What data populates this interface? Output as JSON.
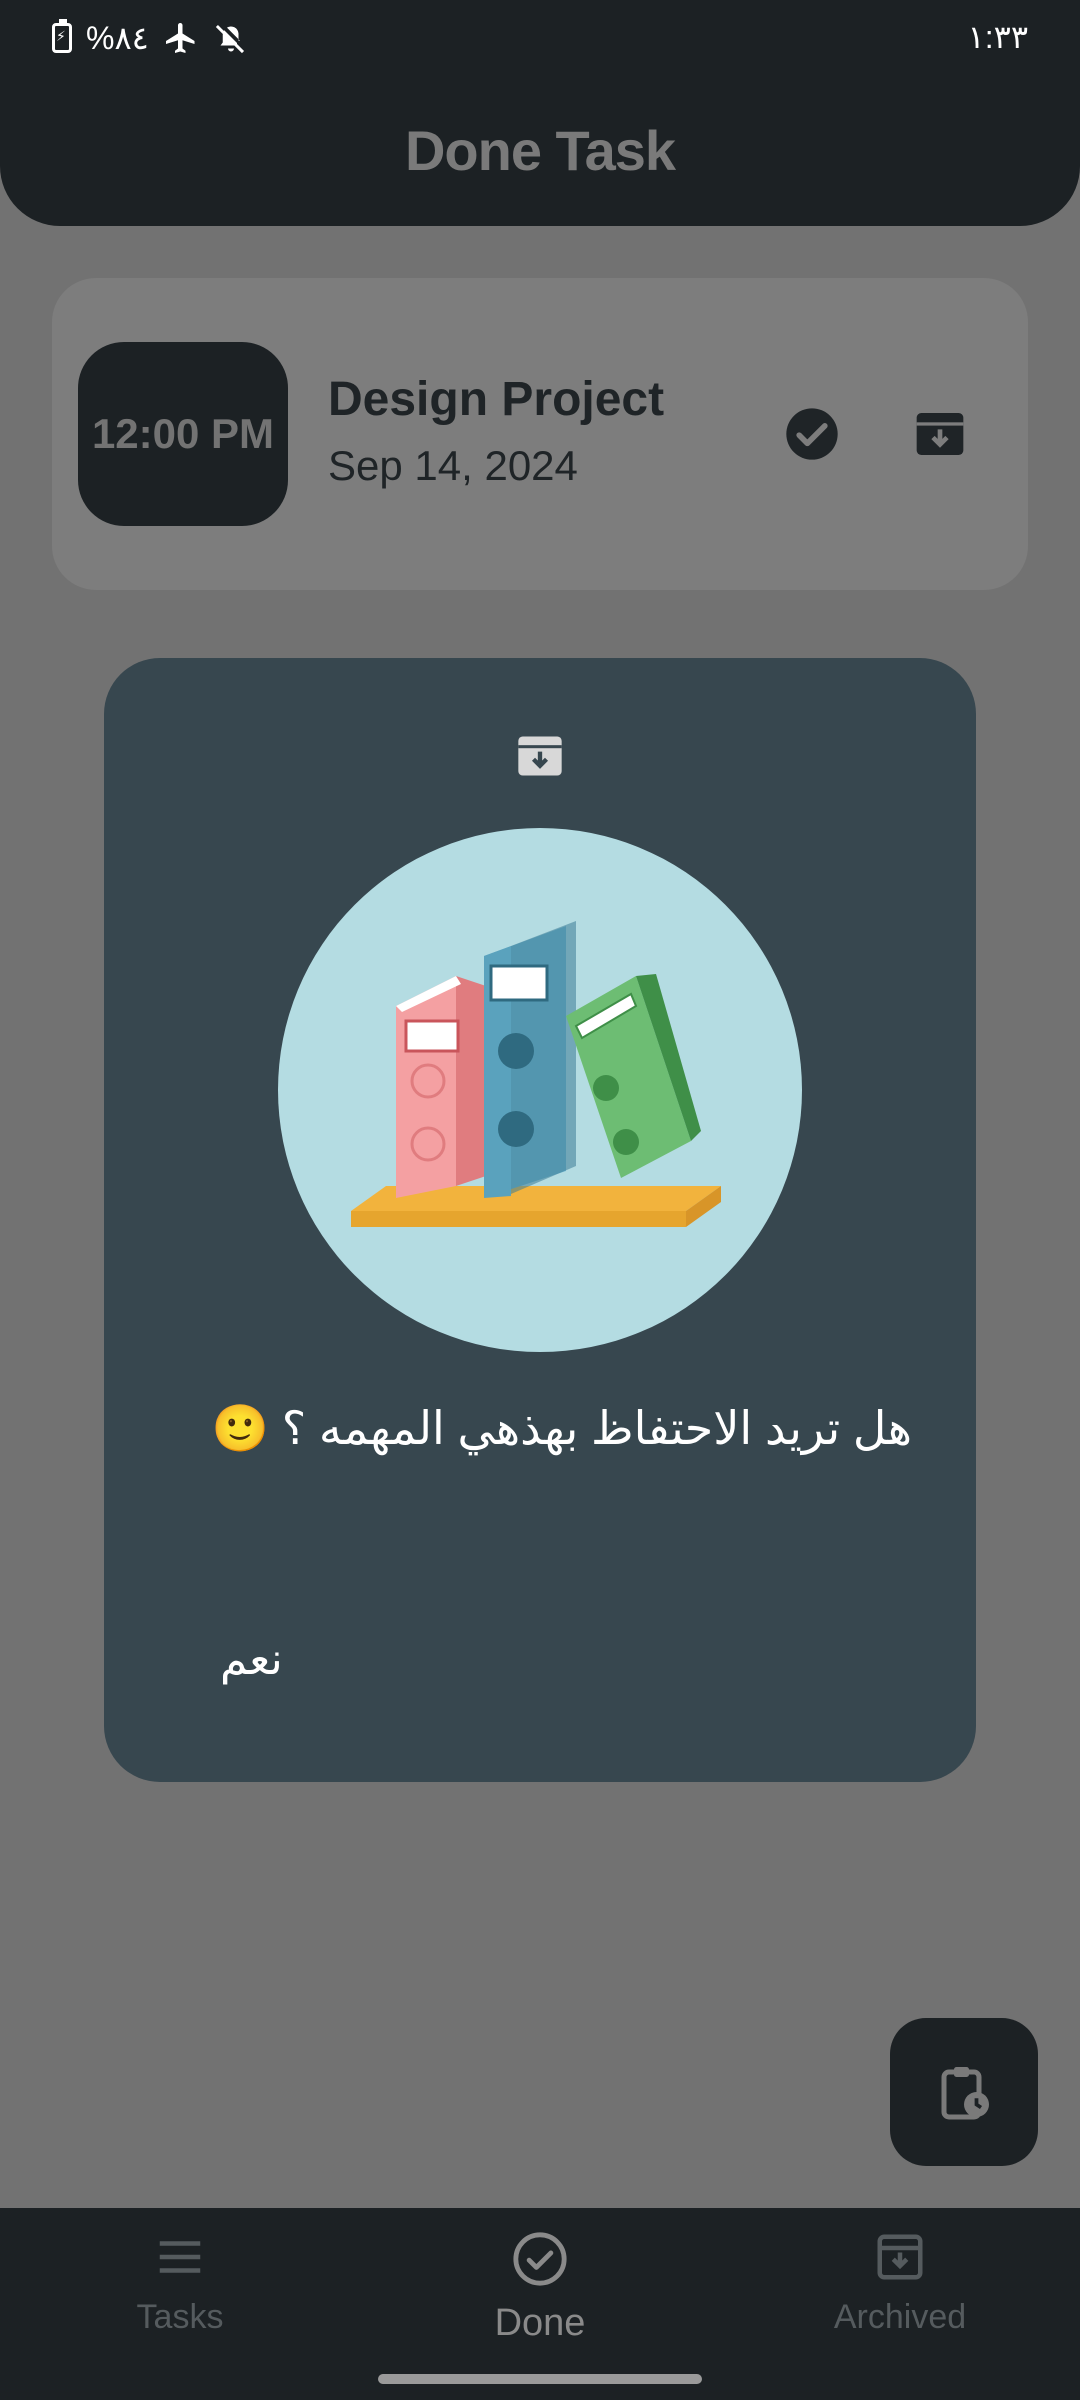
{
  "status_bar": {
    "battery": "%٨٤",
    "time": "١:٣٣"
  },
  "header": {
    "title": "Done Task"
  },
  "task": {
    "time": "12:00 PM",
    "title": "Design Project",
    "date": "Sep 14, 2024"
  },
  "dialog": {
    "message": "هل تريد الاحتفاظ بهذهي المهمه ؟ 🙂",
    "confirm_label": "نعم"
  },
  "bottom_nav": {
    "items": [
      {
        "label": "Tasks",
        "icon": "menu-icon"
      },
      {
        "label": "Done",
        "icon": "check-circle-icon"
      },
      {
        "label": "Archived",
        "icon": "archive-icon"
      }
    ],
    "active": "Done"
  },
  "colors": {
    "header_bg": "#1c2124",
    "scrim_bg": "#727272",
    "dialog_bg": "#37474f",
    "card_bg": "#7d7d7d"
  }
}
